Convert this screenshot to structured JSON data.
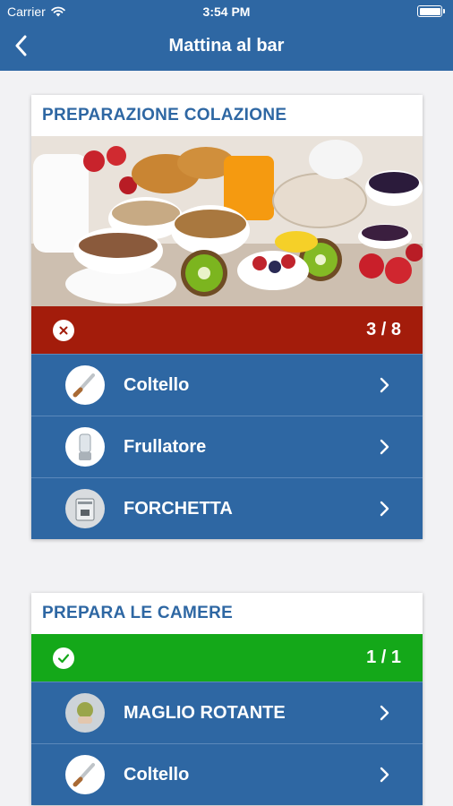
{
  "status_bar": {
    "carrier": "Carrier",
    "time": "3:54 PM"
  },
  "navbar": {
    "title": "Mattina al bar"
  },
  "colors": {
    "brand": "#2e67a3",
    "failed": "#a31c0b",
    "success": "#14a819"
  },
  "sections": [
    {
      "title": "PREPARAZIONE COLAZIONE",
      "has_image": true,
      "status": "failed",
      "status_icon": "close-icon",
      "progress": "3 / 8",
      "items": [
        {
          "label": "Coltello",
          "icon": "knife-icon"
        },
        {
          "label": "Frullatore",
          "icon": "blender-icon"
        },
        {
          "label": "FORCHETTA",
          "icon": "coffee-machine-icon"
        }
      ]
    },
    {
      "title": "PREPARA LE CAMERE",
      "has_image": false,
      "status": "success",
      "status_icon": "check-icon",
      "progress": "1 / 1",
      "items": [
        {
          "label": "MAGLIO ROTANTE",
          "icon": "mallet-icon"
        },
        {
          "label": "Coltello",
          "icon": "knife-icon"
        }
      ]
    }
  ]
}
